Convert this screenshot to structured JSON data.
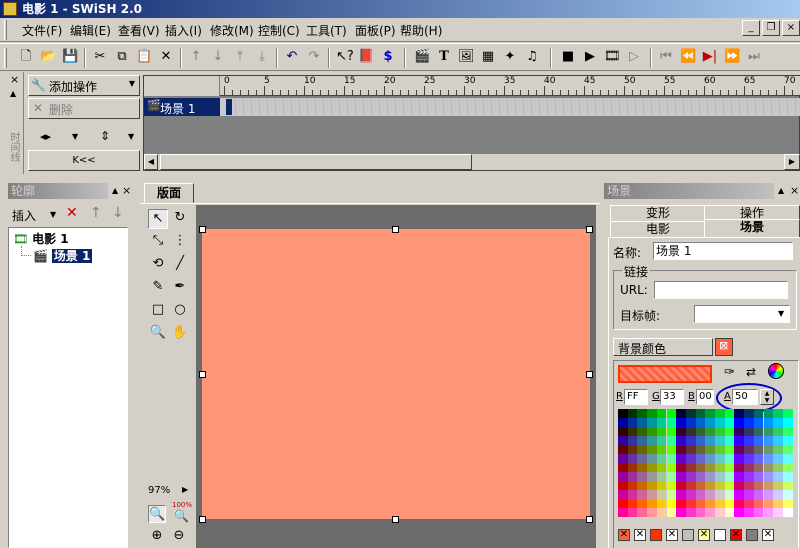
{
  "app": {
    "title": "电影 1 - SWiSH 2.0"
  },
  "menu": [
    "文件(F)",
    "编辑(E)",
    "查看(V)",
    "插入(I)",
    "修改(M)",
    "控制(C)",
    "工具(T)",
    "面板(P)",
    "帮助(H)"
  ],
  "window_buttons": {
    "minimize": "_",
    "restore": "❐",
    "close": "×"
  },
  "timeline_panel": {
    "add_action": "添加操作",
    "delete": "删除",
    "side_label": "时间线",
    "rewind_icon": "K<<",
    "scene_row": "场景 1",
    "ruler": [
      "0",
      "5",
      "10",
      "15",
      "20",
      "25",
      "30",
      "35",
      "40",
      "45",
      "50",
      "55",
      "60",
      "65",
      "70"
    ]
  },
  "outline_panel": {
    "title": "轮廓",
    "insert_label": "插入",
    "root": "电影 1",
    "child": "场景 1"
  },
  "layout_panel": {
    "tab": "版面",
    "zoom": "97%",
    "zoom_100": "100%",
    "stage_color": "#FF9677"
  },
  "scene_panel": {
    "title": "场景",
    "tabs_top": [
      "变形",
      "操作"
    ],
    "tabs_bottom": [
      "电影",
      "场景"
    ],
    "name_label": "名称:",
    "name_value": "场景 1",
    "link_group": "链接",
    "url_label": "URL:",
    "url_value": "",
    "target_frame_label": "目标帧:",
    "target_frame_value": "",
    "bg_color_label": "背景颜色",
    "rgba": {
      "r_label": "R",
      "r": "FF",
      "g_label": "G",
      "g": "33",
      "b_label": "B",
      "b": "00",
      "a_label": "A",
      "a": "50"
    }
  },
  "colors": {
    "accent": "#0a246a",
    "stage": "#FF9677",
    "highlight_oval": "#0000cc"
  }
}
